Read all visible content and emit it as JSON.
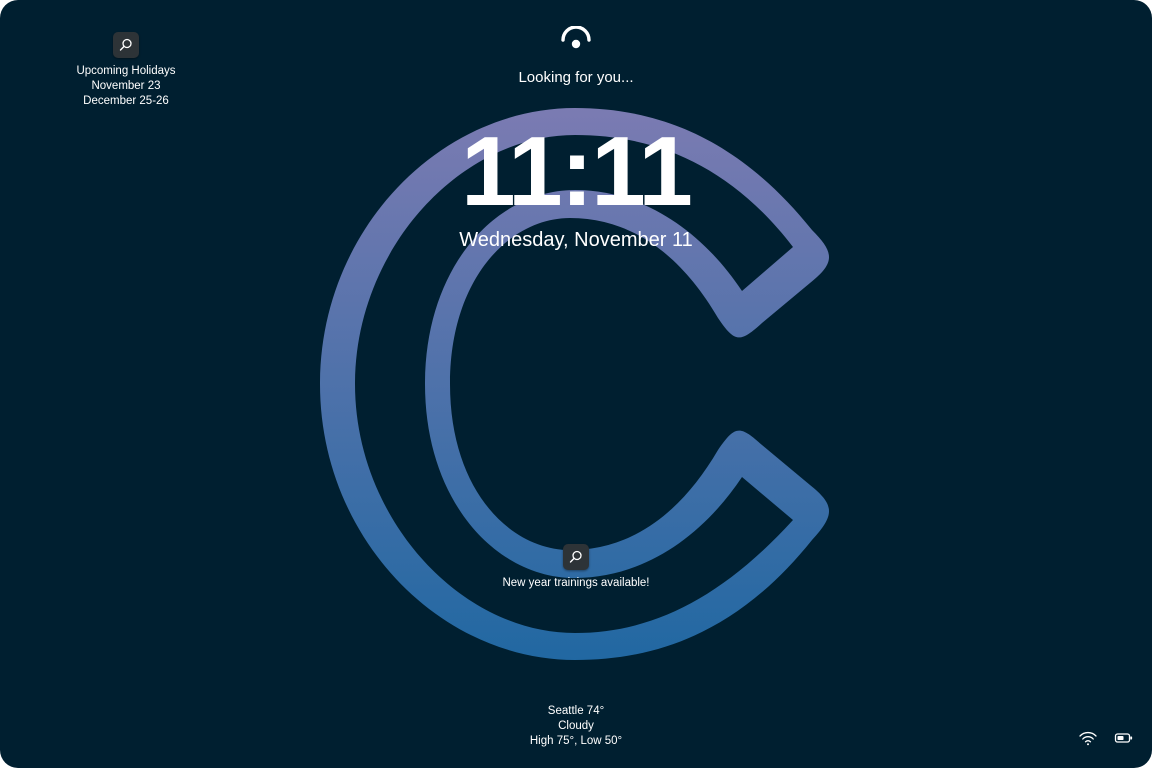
{
  "lock_screen": {
    "status_text": "Looking for you...",
    "time": "11:11",
    "date": "Wednesday, November 11"
  },
  "widgets": {
    "holidays": {
      "icon": "search-icon",
      "lines": [
        "Upcoming Holidays",
        "November 23",
        "December 25-26"
      ]
    },
    "trainings": {
      "icon": "search-icon",
      "text": "New year trainings available!"
    },
    "weather": {
      "lines": [
        "Seattle 74°",
        "Cloudy",
        "High 75°, Low 50°"
      ]
    }
  },
  "system_tray": {
    "icons": [
      "wifi-icon",
      "battery-icon"
    ]
  },
  "colors": {
    "background": "#001f30",
    "logo_gradient_top": "#7b7bb2",
    "logo_gradient_bottom": "#2168a2",
    "text": "#ffffff",
    "widget_icon_bg": "#2d3337"
  }
}
